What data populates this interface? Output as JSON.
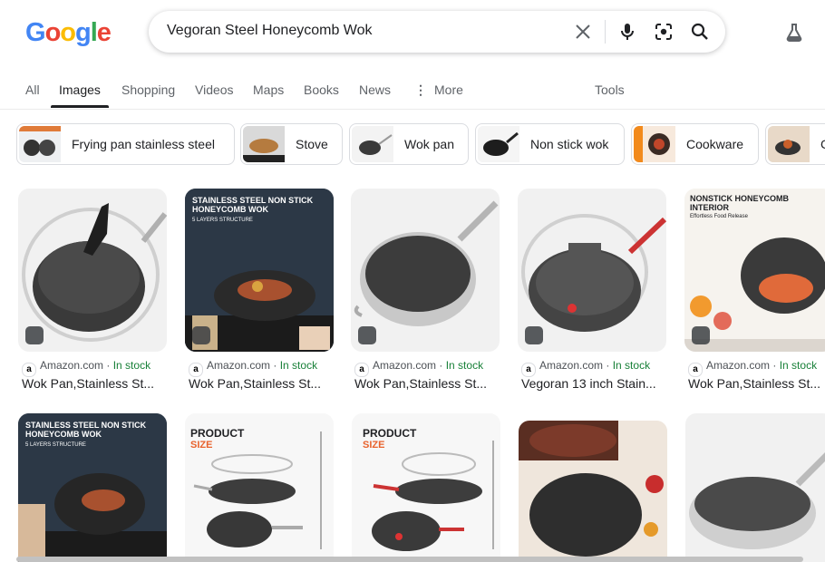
{
  "logo": {
    "letters": [
      "G",
      "o",
      "o",
      "g",
      "l",
      "e"
    ],
    "colors": [
      "#4285F4",
      "#EA4335",
      "#FBBC05",
      "#4285F4",
      "#34A853",
      "#EA4335"
    ]
  },
  "search": {
    "query": "Vegoran Steel Honeycomb Wok"
  },
  "icons": {
    "clear": "close-icon",
    "voice": "mic-icon",
    "lens": "camera-icon",
    "search": "search-icon",
    "labs": "flask-icon"
  },
  "tabs": [
    {
      "label": "All"
    },
    {
      "label": "Images"
    },
    {
      "label": "Shopping"
    },
    {
      "label": "Videos"
    },
    {
      "label": "Maps"
    },
    {
      "label": "Books"
    },
    {
      "label": "News"
    },
    {
      "label": "More"
    },
    {
      "label": "Tools"
    }
  ],
  "chips": [
    {
      "label": "Frying pan stainless steel"
    },
    {
      "label": "Stove"
    },
    {
      "label": "Wok pan"
    },
    {
      "label": "Non stick wok"
    },
    {
      "label": "Cookware"
    },
    {
      "label": "C"
    }
  ],
  "results_row1": [
    {
      "source": "Amazon.com",
      "stock": "In stock",
      "caption": "Wok Pan,Stainless St..."
    },
    {
      "source": "Amazon.com",
      "stock": "In stock",
      "caption": "Wok Pan,Stainless St...",
      "overlay": "STAINLESS STEEL NON STICK HONEYCOMB WOK",
      "overlay_sub": "5 LAYERS STRUCTURE"
    },
    {
      "source": "Amazon.com",
      "stock": "In stock",
      "caption": "Wok Pan,Stainless St..."
    },
    {
      "source": "Amazon.com",
      "stock": "In stock",
      "caption": "Vegoran 13 inch Stain..."
    },
    {
      "source": "Amazon.com",
      "stock": "In stock",
      "caption": "Wok Pan,Stainless St...",
      "overlay": "NONSTICK HONEYCOMB INTERIOR",
      "overlay_sub": "Effortless Food Release"
    }
  ],
  "results_row2": [
    {
      "overlay": "STAINLESS STEEL NON STICK HONEYCOMB WOK",
      "overlay_sub": "5 LAYERS STRUCTURE"
    },
    {
      "overlay": "PRODUCT",
      "overlay_sub": "SIZE"
    },
    {
      "overlay": "PRODUCT",
      "overlay_sub": "SIZE"
    },
    {},
    {}
  ],
  "separator": "·",
  "colors": {
    "accent": "#1a73e8",
    "stock": "#188038"
  }
}
